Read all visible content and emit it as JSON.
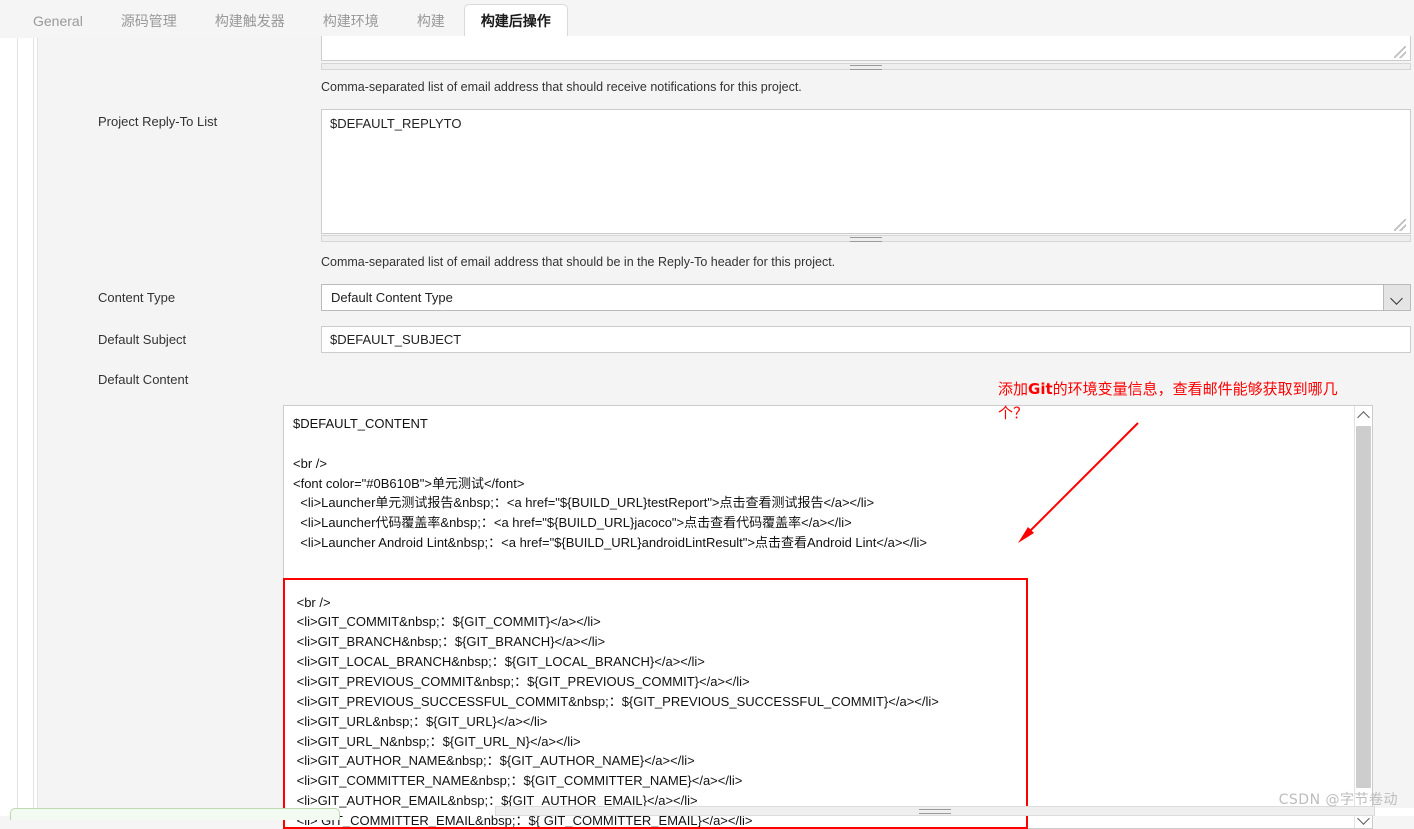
{
  "tabs": [
    {
      "label": "General",
      "active": false
    },
    {
      "label": "源码管理",
      "active": false
    },
    {
      "label": "构建触发器",
      "active": false
    },
    {
      "label": "构建环境",
      "active": false
    },
    {
      "label": "构建",
      "active": false
    },
    {
      "label": "构建后操作",
      "active": true
    }
  ],
  "rows": {
    "recipient_help": "Comma-separated list of email address that should receive notifications for this project.",
    "reply_to": {
      "label": "Project Reply-To List",
      "value": "$DEFAULT_REPLYTO",
      "help": "Comma-separated list of email address that should be in the Reply-To header for this project."
    },
    "content_type": {
      "label": "Content Type",
      "value": "Default Content Type"
    },
    "default_subject": {
      "label": "Default Subject",
      "value": "$DEFAULT_SUBJECT"
    },
    "default_content": {
      "label": "Default Content",
      "lines": [
        "$DEFAULT_CONTENT",
        "",
        "<br />",
        "<font color=\"#0B610B\">单元测试</font>",
        "  <li>Launcher单元测试报告&nbsp;：<a href=\"${BUILD_URL}testReport\">点击查看测试报告</a></li>",
        "  <li>Launcher代码覆盖率&nbsp;：<a href=\"${BUILD_URL}jacoco\">点击查看代码覆盖率</a></li>",
        "  <li>Launcher Android Lint&nbsp;：<a href=\"${BUILD_URL}androidLintResult\">点击查看Android Lint</a></li>",
        "",
        "",
        " <br />",
        " <li>GIT_COMMIT&nbsp;：${GIT_COMMIT}</a></li>",
        " <li>GIT_BRANCH&nbsp;：${GIT_BRANCH}</a></li>",
        " <li>GIT_LOCAL_BRANCH&nbsp;：${GIT_LOCAL_BRANCH}</a></li>",
        " <li>GIT_PREVIOUS_COMMIT&nbsp;：${GIT_PREVIOUS_COMMIT}</a></li>",
        " <li>GIT_PREVIOUS_SUCCESSFUL_COMMIT&nbsp;：${GIT_PREVIOUS_SUCCESSFUL_COMMIT}</a></li>",
        " <li>GIT_URL&nbsp;：${GIT_URL}</a></li>",
        " <li>GIT_URL_N&nbsp;：${GIT_URL_N}</a></li>",
        " <li>GIT_AUTHOR_NAME&nbsp;：${GIT_AUTHOR_NAME}</a></li>",
        " <li>GIT_COMMITTER_NAME&nbsp;：${GIT_COMMITTER_NAME}</a></li>",
        " <li>GIT_AUTHOR_EMAIL&nbsp;：${GIT_AUTHOR_EMAIL}</a></li>",
        " <li> GIT_COMMITTER_EMAIL&nbsp;：${ GIT_COMMITTER_EMAIL}</a></li>"
      ]
    }
  },
  "annotation": {
    "prefix": "添加",
    "emphasis": "Git",
    "suffix": "的环境变量信息，查看邮件能够获取到哪几个？",
    "color": "#ff0000"
  },
  "help_icon_glyph": "?",
  "watermark": "CSDN @字节卷动",
  "colors": {
    "accent_red": "#ff0000",
    "help_blue": "#5b7fa6",
    "panel_bg": "#f4f4f4",
    "page_bg": "#f5f5f5"
  }
}
